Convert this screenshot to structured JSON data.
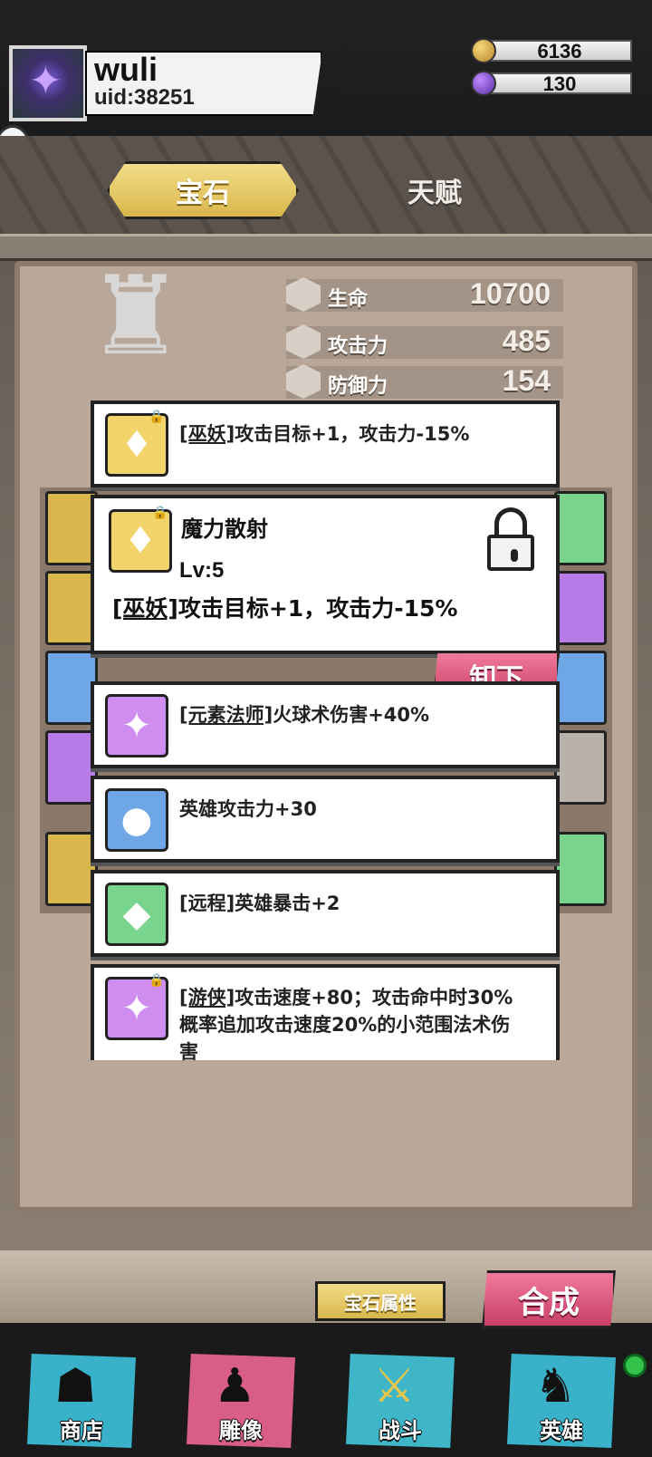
{
  "user": {
    "name": "wuli",
    "uid": "uid:38251"
  },
  "currency": {
    "gold": "6136",
    "gems": "130"
  },
  "tabs": {
    "gem": "宝石",
    "talent": "天赋"
  },
  "stats": [
    {
      "label": "生命",
      "value": "10700"
    },
    {
      "label": "攻击力",
      "value": "485"
    },
    {
      "label": "防御力",
      "value": "154"
    }
  ],
  "detail": {
    "title": "魔力散射",
    "level": "Lv:5",
    "tag": "[巫妖]",
    "desc": "攻击目标+1，攻击力-15%",
    "unequip": "卸下"
  },
  "cards": [
    {
      "tag": "[巫妖]",
      "text": "攻击目标+1，攻击力-15%"
    },
    {
      "tag": "[元素法师]",
      "text": "火球术伤害+40%"
    },
    {
      "tag": "",
      "text": "英雄攻击力+30"
    },
    {
      "tag": "",
      "text": "[远程]英雄暴击+2"
    },
    {
      "tag": "[游侠]",
      "text": "攻击速度+80；攻击命中时30%",
      "text2": "概率追加攻击速度20%的小范围法术伤",
      "text3": "害"
    }
  ],
  "buttons": {
    "attr": "宝石属性",
    "compose": "合成"
  },
  "nav": [
    {
      "label": "商店",
      "icon": "shop-icon"
    },
    {
      "label": "雕像",
      "icon": "statue-icon"
    },
    {
      "label": "战斗",
      "icon": "battle-icon"
    },
    {
      "label": "英雄",
      "icon": "hero-icon"
    }
  ],
  "colors": {
    "gold": "#d9b64c",
    "pink": "#c94067",
    "purple": "#b97be8",
    "blue": "#6fa6e6",
    "green": "#79d48e",
    "panel": "#b9a89a"
  }
}
